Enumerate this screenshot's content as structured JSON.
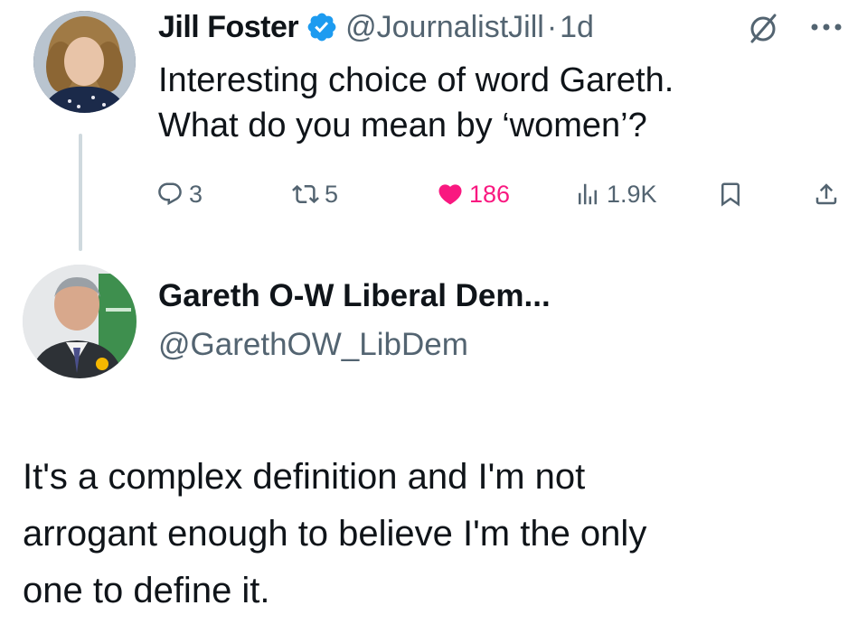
{
  "tweet": {
    "author_name": "Jill Foster",
    "handle": "@JournalistJill",
    "separator": "·",
    "time": "1d",
    "text_lines": [
      "Interesting choice of word Gareth.",
      "What do you mean by ‘women’?"
    ],
    "stats": {
      "replies": "3",
      "reposts": "5",
      "likes": "186",
      "views": "1.9K"
    },
    "icons": {
      "verified": "verified-badge-icon",
      "grok": "grok-icon",
      "more": "more-options-icon",
      "reply": "reply-icon",
      "repost": "repost-icon",
      "like": "heart-icon",
      "views": "views-chart-icon",
      "bookmark": "bookmark-icon",
      "share": "share-icon"
    }
  },
  "reply": {
    "author_name": "Gareth O-W Liberal Dem...",
    "handle": "@GarethOW_LibDem",
    "text_lines": [
      "It's a complex definition and I'm not",
      "arrogant enough to believe I'm the only",
      "one to define it."
    ]
  },
  "colors": {
    "text_primary": "#0f1419",
    "text_secondary": "#536471",
    "like_active": "#f91880",
    "verified_blue": "#1d9bf0",
    "thread_line": "#cfd9de"
  }
}
